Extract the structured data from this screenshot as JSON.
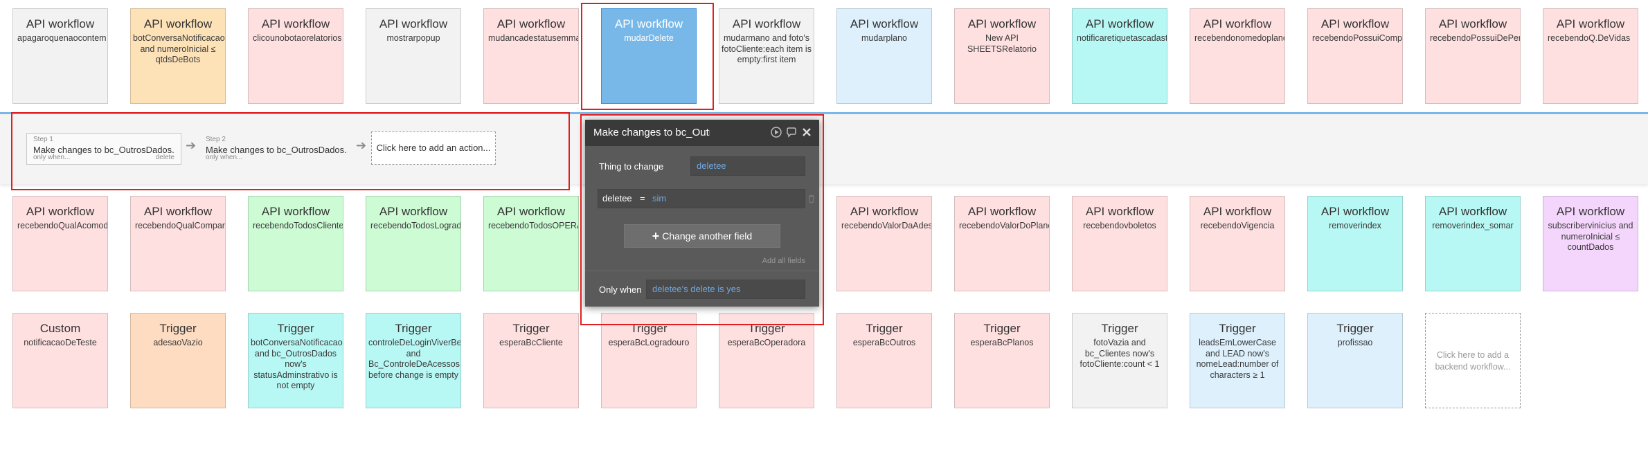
{
  "cards_row1": [
    {
      "title": "API workflow",
      "name": "apagaroquenaocontem",
      "color": "#f2f2f2"
    },
    {
      "title": "API workflow",
      "name": "botConversaNotificacao and numeroInicial ≤ qtdsDeBots",
      "color": "#fde2b8"
    },
    {
      "title": "API workflow",
      "name": "clicounobotaorelatorios",
      "color": "#ffe0e0"
    },
    {
      "title": "API workflow",
      "name": "mostrarpopup",
      "color": "#f2f2f2"
    },
    {
      "title": "API workflow",
      "name": "mudancadestatusemma",
      "color": "#ffe0e0"
    },
    {
      "title": "API workflow",
      "name": "mudarDelete",
      "color": "#78b8e8"
    },
    {
      "title": "API workflow",
      "name": "mudarmano and foto's fotoCliente:each item is empty:first item",
      "color": "#f2f2f2"
    },
    {
      "title": "API workflow",
      "name": "mudarplano",
      "color": "#ddf0fc"
    },
    {
      "title": "API workflow",
      "name": "New API SHEETSRelatorio",
      "color": "#ffe0e0"
    },
    {
      "title": "API workflow",
      "name": "notificaretiquetascadast",
      "color": "#b8f8f4"
    },
    {
      "title": "API workflow",
      "name": "recebendonomedoplano",
      "color": "#ffe0e0"
    },
    {
      "title": "API workflow",
      "name": "recebendoPossuiCompr",
      "color": "#ffe0e0"
    },
    {
      "title": "API workflow",
      "name": "recebendoPossuiDePen",
      "color": "#ffe0e0"
    },
    {
      "title": "API workflow",
      "name": "recebendoQ.DeVidas",
      "color": "#ffe0e0"
    }
  ],
  "cards_row2": [
    {
      "title": "API workflow",
      "name": "recebendoQualAcomod",
      "color": "#ffe0e0"
    },
    {
      "title": "API workflow",
      "name": "recebendoQualCompart",
      "color": "#ffe0e0"
    },
    {
      "title": "API workflow",
      "name": "recebendoTodosCliente",
      "color": "#ccfbd4"
    },
    {
      "title": "API workflow",
      "name": "recebendoTodosLograd",
      "color": "#ccfbd4"
    },
    {
      "title": "API workflow",
      "name": "recebendoTodosOPERA",
      "color": "#ccfbd4"
    },
    {
      "title": "API workflow",
      "name": "recebendoValorDaAdes",
      "color": "#ffe0e0"
    },
    {
      "title": "API workflow",
      "name": "recebendoValorDoPlano",
      "color": "#ffe0e0"
    },
    {
      "title": "API workflow",
      "name": "recebendovboletos",
      "color": "#ffe0e0"
    },
    {
      "title": "API workflow",
      "name": "recebendoVigencia",
      "color": "#ffe0e0"
    },
    {
      "title": "API workflow",
      "name": "removerindex",
      "color": "#b8f8f4"
    },
    {
      "title": "API workflow",
      "name": "removerindex_somar",
      "color": "#b8f8f4"
    },
    {
      "title": "API workflow",
      "name": "subscribervinicius and numeroInicial ≤ countDados",
      "color": "#f4d6fc"
    }
  ],
  "cards_row3": [
    {
      "title": "Custom",
      "name": "notificacaoDeTeste",
      "color": "#ffe0e0"
    },
    {
      "title": "Trigger",
      "name": "adesaoVazio",
      "color": "#fddcc2"
    },
    {
      "title": "Trigger",
      "name": "botConversaNotificacao and bc_OutrosDados now's statusAdminstrativo is not empty",
      "color": "#b8f8f4"
    },
    {
      "title": "Trigger",
      "name": "controleDeLoginViverBem and Bc_ControleDeAcessosDB before change is empty",
      "color": "#b8f8f4"
    },
    {
      "title": "Trigger",
      "name": "esperaBcCliente",
      "color": "#ffe0e0"
    },
    {
      "title": "Trigger",
      "name": "esperaBcLogradouro",
      "color": "#ffe0e0"
    },
    {
      "title": "Trigger",
      "name": "esperaBcOperadora",
      "color": "#ffe0e0"
    },
    {
      "title": "Trigger",
      "name": "esperaBcOutros",
      "color": "#ffe0e0"
    },
    {
      "title": "Trigger",
      "name": "esperaBcPlanos",
      "color": "#ffe0e0"
    },
    {
      "title": "Trigger",
      "name": "fotoVazia and bc_Clientes now's fotoCliente:count < 1",
      "color": "#f2f2f2"
    },
    {
      "title": "Trigger",
      "name": "leadsEmLowerCase and LEAD now's nomeLead:number of characters ≥ 1",
      "color": "#ddf0fc"
    },
    {
      "title": "Trigger",
      "name": "profissao",
      "color": "#ddf0fc"
    }
  ],
  "add_backend": "Click here to add a backend workflow...",
  "steps": [
    {
      "num": "Step 1",
      "desc": "Make changes to bc_OutrosDados...",
      "when": "only when...",
      "del": "delete"
    },
    {
      "num": "Step 2",
      "desc": "Make changes to bc_OutrosDados...",
      "when": "only when..."
    }
  ],
  "add_action": "Click here to add an action...",
  "property_editor": {
    "title": "Make changes to bc_OutrosDados",
    "thing_label": "Thing to change",
    "thing_value": "deletee",
    "field_name": "deletee",
    "field_eq": "=",
    "field_value": "sim",
    "change_btn": "Change another field",
    "add_all": "Add all fields",
    "only_when_label": "Only when",
    "only_when_value": "deletee's delete is yes"
  },
  "icons": {
    "play": "play-icon",
    "comment": "comment-icon",
    "close": "close-icon",
    "trash": "trash-icon",
    "plus": "plus-icon",
    "arrow": "arrow-right-icon"
  },
  "colors": {
    "selected_border": "#3d8ed9",
    "highlight": "#e02020",
    "panel_accent": "#7ab6e6"
  }
}
